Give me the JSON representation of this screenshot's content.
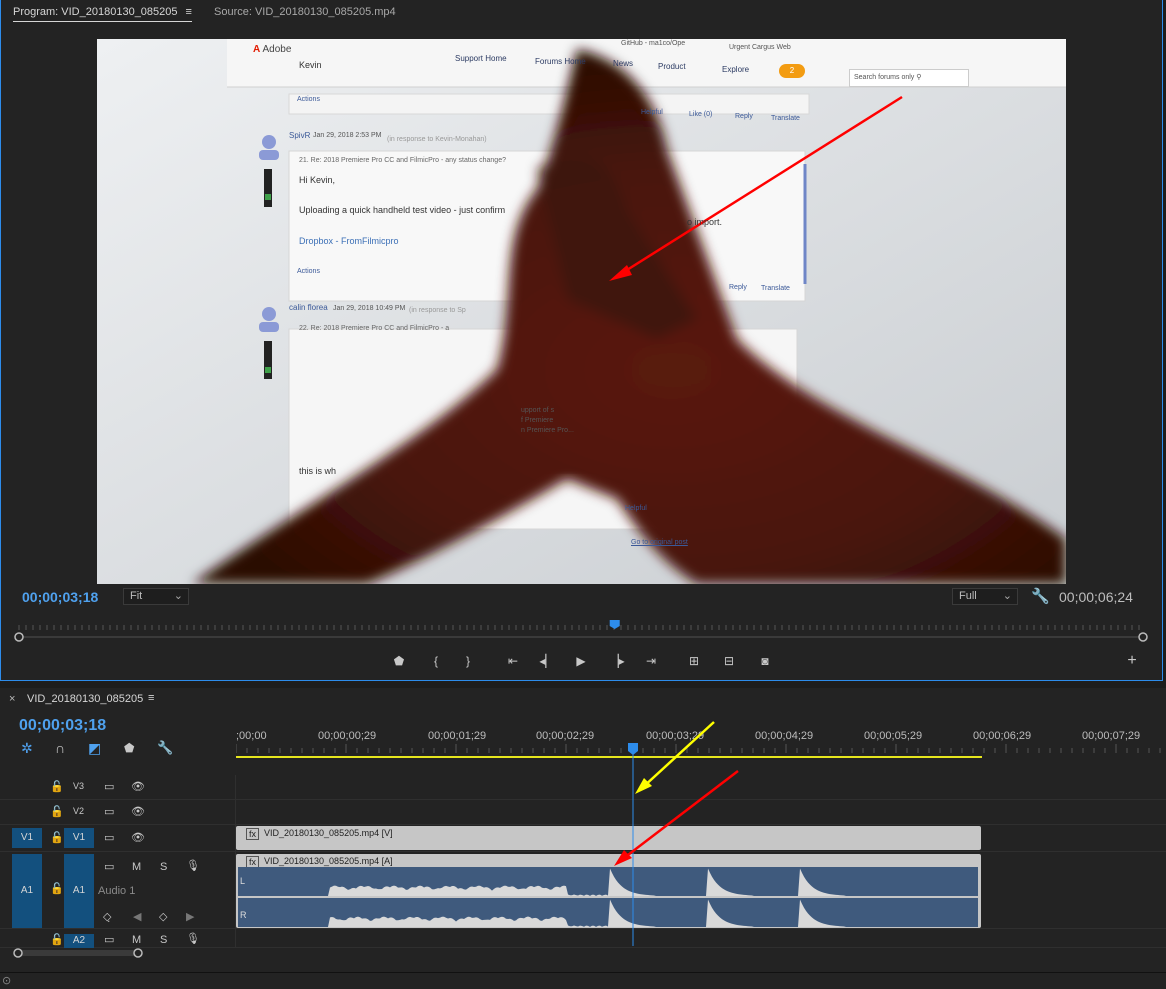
{
  "monitor": {
    "program_tab": "Program: VID_20180130_085205",
    "source_tab": "Source: VID_20180130_085205.mp4",
    "current_time": "00;00;03;18",
    "duration": "00;00;06;24",
    "zoom_value": "Fit",
    "resolution_value": "Full",
    "playhead_fraction": 0.53,
    "controls": [
      "marker-icon",
      "mark-in-icon",
      "mark-out-icon",
      "go-to-in-icon",
      "step-back-icon",
      "play-icon",
      "step-forward-icon",
      "go-to-out-icon",
      "lift-icon",
      "extract-icon",
      "export-frame-icon"
    ]
  },
  "video": {
    "site": {
      "logo": "Adobe",
      "nav": [
        "Support Home",
        "Forums Home",
        "News",
        "Product",
        "Explore"
      ],
      "badge_count": "2",
      "search_placeholder": "Search forums only",
      "bookmarks": [
        "GitHub - ma1co/Ope",
        "Urgent Cargus Web"
      ]
    },
    "posts": [
      {
        "author": "Kevin",
        "actions": "Actions"
      },
      {
        "author": "SpivR",
        "date": "Jan 29, 2018 2:53 PM",
        "reply_to": "(in response to Kevin-Monahan)",
        "title": "21. Re: 2018 Premiere Pro CC and FilmicPro - any status change?",
        "greeting": "Hi Kevin,",
        "body": "Uploading a quick handheld test video - just confirm",
        "body_tail": "o import.",
        "link": "Dropbox - FromFilmicpro",
        "actions": "Actions",
        "helpful": "Helpful",
        "like": "Like (0)",
        "reply": "Reply",
        "translate": "Translate"
      },
      {
        "author": "calin florea",
        "date": "Jan 29, 2018 10:49 PM",
        "reply_to": "(in response to Sp",
        "title": "22. Re: 2018 Premiere Pro CC and FilmicPro - a",
        "body": "this is wh",
        "helpful": "Helpful",
        "reply": "Reply",
        "translate": "Translate",
        "goto": "Go to original post"
      }
    ],
    "fragments": [
      "upport of s",
      "f Premiere",
      "n Premiere Pro..."
    ]
  },
  "timeline": {
    "sequence_tab": "VID_20180130_085205",
    "current_time": "00;00;03;18",
    "ruler_labels": [
      ";00;00",
      "00;00;00;29",
      "00;00;01;29",
      "00;00;02;29",
      "00;00;03;29",
      "00;00;04;29",
      "00;00;05;29",
      "00;00;06;29",
      "00;00;07;29"
    ],
    "tracks": {
      "v3": "V3",
      "v2": "V2",
      "v1": "V1",
      "v1_src": "V1",
      "a1": "A1",
      "a1_src": "A1",
      "a1_name": "Audio 1",
      "a2": "A2"
    },
    "clips": {
      "video": "VID_20180130_085205.mp4 [V]",
      "audio": "VID_20180130_085205.mp4 [A]",
      "channel_left": "L",
      "channel_right": "R"
    },
    "mute_label": "M",
    "solo_label": "S",
    "fx_label": "fx"
  },
  "colors": {
    "accent_blue": "#4fa1ee",
    "annotation_red": "#ff0000",
    "annotation_yellow": "#ffff00",
    "work_area_yellow": "#e6e61e",
    "audio_clip": "#3f5a7d",
    "video_clip": "#c6c6c6"
  }
}
